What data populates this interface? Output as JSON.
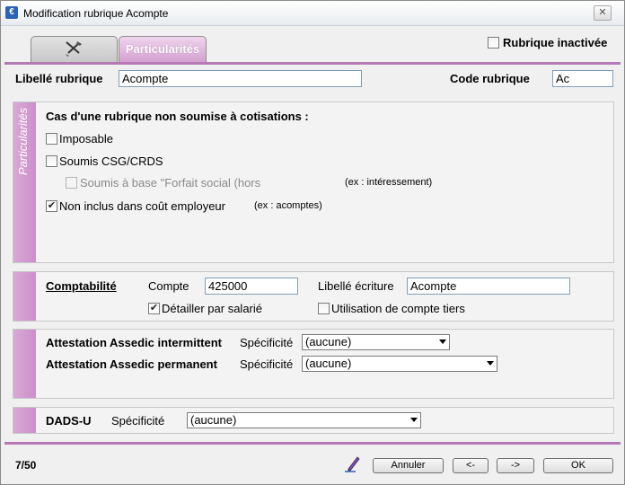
{
  "window": {
    "title": "Modification rubrique Acompte",
    "close_label": "✕"
  },
  "tabs": {
    "icon_tab": "tools-icon",
    "particularites_label": "Particularités"
  },
  "inactive": {
    "label": "Rubrique inactivée",
    "checked": false
  },
  "header": {
    "libelle_label": "Libellé rubrique",
    "libelle_value": "Acompte",
    "code_label": "Code rubrique",
    "code_value": "Ac"
  },
  "particularites": {
    "side_label": "Particularités",
    "heading": "Cas d'une rubrique non soumise à cotisations :",
    "imposable": {
      "label": "Imposable",
      "checked": false
    },
    "csg": {
      "label": "Soumis CSG/CRDS",
      "checked": false
    },
    "forfait": {
      "label": "Soumis à base \"Forfait social (hors",
      "checked": false,
      "note": "(ex : intéressement)"
    },
    "cout": {
      "label": "Non inclus dans coût employeur",
      "checked": true,
      "note": "(ex : acomptes)"
    }
  },
  "comptabilite": {
    "title": "Comptabilité",
    "compte_label": "Compte",
    "compte_value": "425000",
    "libelle_label": "Libellé écriture",
    "libelle_value": "Acompte",
    "detailler": {
      "label": "Détailler par salarié",
      "checked": true
    },
    "tiers": {
      "label": "Utilisation de compte tiers",
      "checked": false
    }
  },
  "assedic": {
    "intermittent_label": "Attestation Assedic intermittent",
    "permanent_label": "Attestation Assedic permanent",
    "specificite_label": "Spécificité",
    "intermittent_value": "(aucune)",
    "permanent_value": "(aucune)"
  },
  "dads": {
    "label": "DADS-U",
    "specificite_label": "Spécificité",
    "value": "(aucune)"
  },
  "footer": {
    "counter": "7/50",
    "pen_icon": "pen-icon",
    "annuler": "Annuler",
    "prev": "<-",
    "next": "->",
    "ok": "OK"
  },
  "colors": {
    "accent": "#b57ab5",
    "stripe": "#d09bcd",
    "tab_active": "#d9a8d6"
  }
}
